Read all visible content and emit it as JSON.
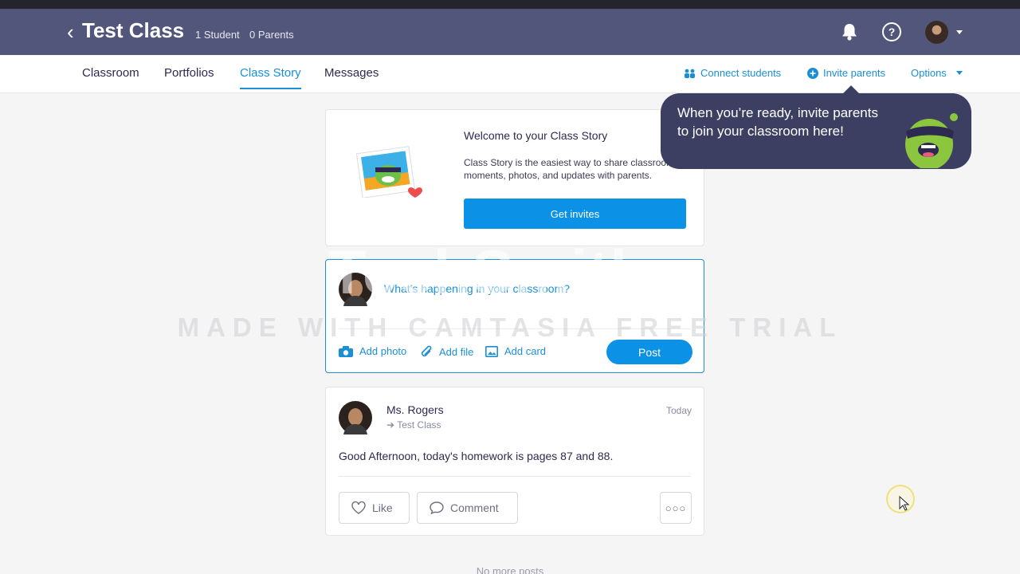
{
  "header": {
    "title": "Test Class",
    "students": "1 Student",
    "parents": "0 Parents"
  },
  "tabs": [
    {
      "label": "Classroom"
    },
    {
      "label": "Portfolios"
    },
    {
      "label": "Class Story"
    },
    {
      "label": "Messages"
    }
  ],
  "actions": {
    "connect_students": "Connect students",
    "invite_parents": "Invite parents",
    "options": "Options"
  },
  "welcome": {
    "title": "Welcome to your Class Story",
    "description": "Class Story is the easiest way to share classroom moments, photos, and updates with parents.",
    "button": "Get invites"
  },
  "composer": {
    "placeholder": "What's happening in your classroom?",
    "add_photo": "Add photo",
    "add_file": "Add file",
    "add_card": "Add card",
    "post": "Post"
  },
  "post": {
    "author": "Ms. Rogers",
    "class_name": "Test Class",
    "time": "Today",
    "body": "Good Afternoon, today's homework is pages 87 and 88.",
    "like": "Like",
    "comment": "Comment",
    "more": "○○○"
  },
  "footer": {
    "no_more": "No more posts"
  },
  "tooltip": {
    "text": "When you’re ready, invite parents to join your classroom here!"
  },
  "watermark": {
    "logo": "TechSmith",
    "text": "MADE WITH CAMTASIA FREE TRIAL"
  },
  "colors": {
    "header_bg": "#52567a",
    "accent": "#0b92e6",
    "tooltip_bg": "#3d3f62"
  }
}
